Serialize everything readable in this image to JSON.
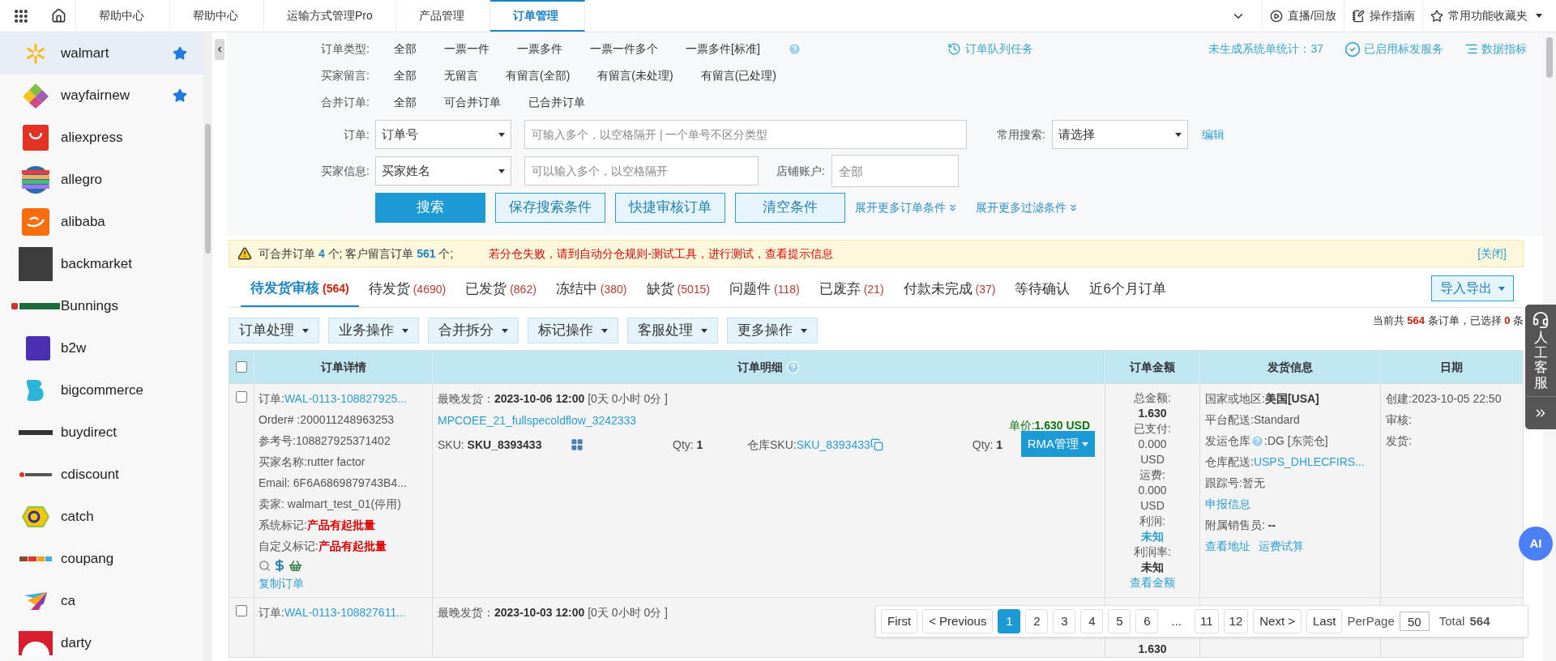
{
  "top_nav": {
    "tabs": [
      {
        "label": "帮助中心",
        "selected": false
      },
      {
        "label": "帮助中心",
        "selected": false
      },
      {
        "label": "运输方式管理Pro",
        "selected": false
      },
      {
        "label": "产品管理",
        "selected": false
      },
      {
        "label": "订单管理",
        "selected": true
      }
    ],
    "right_items": [
      {
        "label": "直播/回放",
        "kind": "play"
      },
      {
        "label": "操作指南",
        "kind": "guide"
      },
      {
        "label": "常用功能收藏夹",
        "kind": "favorites"
      }
    ]
  },
  "sidebar": {
    "items": [
      {
        "name": "walmart",
        "favorite": true,
        "selected": true
      },
      {
        "name": "wayfairnew",
        "favorite": true,
        "selected": false
      },
      {
        "name": "aliexpress",
        "favorite": false,
        "selected": false
      },
      {
        "name": "allegro",
        "favorite": false,
        "selected": false
      },
      {
        "name": "alibaba",
        "favorite": false,
        "selected": false
      },
      {
        "name": "backmarket",
        "favorite": false,
        "selected": false
      },
      {
        "name": "Bunnings",
        "favorite": false,
        "selected": false
      },
      {
        "name": "b2w",
        "favorite": false,
        "selected": false
      },
      {
        "name": "bigcommerce",
        "favorite": false,
        "selected": false
      },
      {
        "name": "buydirect",
        "favorite": false,
        "selected": false
      },
      {
        "name": "cdiscount",
        "favorite": false,
        "selected": false
      },
      {
        "name": "catch",
        "favorite": false,
        "selected": false
      },
      {
        "name": "coupang",
        "favorite": false,
        "selected": false
      },
      {
        "name": "ca",
        "favorite": false,
        "selected": false
      },
      {
        "name": "darty",
        "favorite": false,
        "selected": false
      }
    ]
  },
  "filters": {
    "option_rows": [
      {
        "label": "订单类型:",
        "options": [
          "全部",
          "一票一件",
          "一票多件",
          "一票一件多个",
          "一票多件[标准]"
        ],
        "help": true
      },
      {
        "label": "买家留言:",
        "options": [
          "全部",
          "无留言",
          "有留言(全部)",
          "有留言(未处理)",
          "有留言(已处理)"
        ],
        "help": false
      },
      {
        "label": "合并订单:",
        "options": [
          "全部",
          "可合并订单",
          "已合并订单"
        ],
        "help": false
      }
    ],
    "links": [
      {
        "label": "订单队列任务",
        "kind": "queue"
      },
      {
        "label": "未生成系统单统计：37",
        "kind": "stat"
      },
      {
        "label": "已启用标发服务",
        "kind": "service"
      },
      {
        "label": "数据指标",
        "kind": "metrics"
      }
    ],
    "order": {
      "label": "订单:",
      "select": "订单号",
      "placeholder": "可输入多个，以空格隔开 | 一个单号不区分类型"
    },
    "common_search": {
      "label": "常用搜索:",
      "select": "请选择",
      "edit": "编辑"
    },
    "buyer": {
      "label": "买家信息:",
      "select": "买家姓名",
      "placeholder": "可以输入多个，以空格隔开"
    },
    "store": {
      "label": "店铺账户:",
      "placeholder": "全部"
    },
    "buttons": [
      {
        "label": "搜索",
        "kind": "primary"
      },
      {
        "label": "保存搜索条件",
        "kind": "secondary"
      },
      {
        "label": "快捷审核订单",
        "kind": "secondary"
      },
      {
        "label": "清空条件",
        "kind": "secondary"
      }
    ],
    "expand_links": [
      "展开更多订单条件",
      "展开更多过滤条件"
    ]
  },
  "alert": {
    "summary": "可合并订单 **4** 个; 客户留言订单 **561** 个;",
    "warning": "若分仓失败，请到自动分仓规则-测试工具，进行测试，查看提示信息",
    "close": "[关闭]"
  },
  "status_tabs": [
    {
      "label": "待发货审核",
      "count": "(564)",
      "selected": true
    },
    {
      "label": "待发货",
      "count": "(4690)",
      "selected": false
    },
    {
      "label": "已发货",
      "count": "(862)",
      "selected": false
    },
    {
      "label": "冻结中",
      "count": "(380)",
      "selected": false
    },
    {
      "label": "缺货",
      "count": "(5015)",
      "selected": false
    },
    {
      "label": "问题件",
      "count": "(118)",
      "selected": false
    },
    {
      "label": "已废弃",
      "count": "(21)",
      "selected": false
    },
    {
      "label": "付款未完成",
      "count": "(37)",
      "selected": false
    },
    {
      "label": "等待确认",
      "selected": false
    },
    {
      "label": "近6个月订单",
      "selected": false
    }
  ],
  "import_export": "导入导出",
  "actions": [
    "订单处理",
    "业务操作",
    "合并拆分",
    "标记操作",
    "客服处理",
    "更多操作"
  ],
  "summary": "当前共 **564** 条订单，已选择 **0** 条",
  "table": {
    "header_checked": false,
    "columns": [
      {
        "label": "订单详情",
        "help": false
      },
      {
        "label": "订单明细",
        "help": true
      },
      {
        "label": "订单金额",
        "help": false
      },
      {
        "label": "发货信息",
        "help": false
      },
      {
        "label": "日期",
        "help": false
      }
    ],
    "rows": [
      {
        "checked": false,
        "details": [
          {
            "label": "订单:",
            "value": "WAL-0113-108827925...",
            "kind": "link"
          },
          {
            "label": "Order# :",
            "value": "200011248963253",
            "kind": "plain"
          },
          {
            "label": "参考号:",
            "value": "108827925371402",
            "kind": "plain"
          },
          {
            "label": "买家名称:",
            "value": "rutter factor",
            "kind": "plain"
          },
          {
            "label": "Email: ",
            "value": "6F6A6869879743B4...",
            "kind": "plain"
          },
          {
            "label": "卖家: ",
            "value": "walmart_test_01(停用)",
            "kind": "plain"
          },
          {
            "label": "系统标记:",
            "value": "产品有起批量",
            "kind": "flag"
          },
          {
            "label": "自定义标记:",
            "value": "产品有起批量",
            "kind": "flag"
          }
        ],
        "copy_link": "复制订单",
        "ship_by": "最晚发货：**2023-10-06 12:00** [0天 0小时 0分 ]",
        "product": "MPCOEE_21_fullspecoldflow_3242333",
        "unit_price": "单价:**1.630 USD**",
        "sku": "SKU: **SKU_8393433**",
        "qty": "Qty: **1**",
        "warehouse_sku_label": "仓库SKU:",
        "warehouse_sku": "SKU_8393433",
        "warehouse_qty": "Qty: **1**",
        "rma": "RMA管理",
        "amounts": [
          {
            "text": "总金额:",
            "kind": "label"
          },
          {
            "text": "1.630",
            "kind": "strong"
          },
          {
            "text": "已支付:",
            "kind": "label"
          },
          {
            "text": "0.000",
            "kind": "label"
          },
          {
            "text": "USD",
            "kind": "label"
          },
          {
            "text": "运费:",
            "kind": "label"
          },
          {
            "text": "0.000",
            "kind": "label"
          },
          {
            "text": "USD",
            "kind": "label"
          },
          {
            "text": "利润:",
            "kind": "label"
          },
          {
            "text": "未知",
            "kind": "accent"
          },
          {
            "text": "利润率:",
            "kind": "label"
          },
          {
            "text": "未知",
            "kind": "strong"
          },
          {
            "text": "查看金额",
            "kind": "link"
          }
        ],
        "shipping": [
          {
            "kind": "strong_field",
            "label": "国家或地区:",
            "value": "美国[USA]"
          },
          {
            "kind": "field",
            "label": "平台配送:",
            "value": "Standard"
          },
          {
            "kind": "help_field",
            "label": "发运仓库",
            "value": ":DG [东莞仓]"
          },
          {
            "kind": "link_field",
            "label": "仓库配送:",
            "value": "USPS_DHLECFIRS..."
          },
          {
            "kind": "field",
            "label": "跟踪号:",
            "value": "暂无"
          },
          {
            "kind": "links",
            "links": [
              "申报信息"
            ]
          },
          {
            "kind": "strong_field",
            "label": "附属销售员: ",
            "value": "--"
          },
          {
            "kind": "links",
            "links": [
              "查看地址",
              "运费试算"
            ]
          }
        ],
        "dates": [
          {
            "label": "创建:",
            "value": "2023-10-05 22:50"
          },
          {
            "label": "审核:"
          },
          {
            "label": "发货:"
          }
        ]
      },
      {
        "checked": false,
        "details": [
          {
            "label": "订单:",
            "value": "WAL-0113-108827611...",
            "kind": "link"
          }
        ],
        "ship_by": "最晚发货：**2023-10-03 12:00** [0天 0小时 0分 ]",
        "amounts": [
          {
            "text": "1.630",
            "kind": "strong"
          }
        ]
      }
    ]
  },
  "pagination": {
    "first": "First",
    "previous": "< Previous",
    "pages": [
      {
        "label": "1",
        "selected": true
      },
      {
        "label": "2",
        "selected": false
      },
      {
        "label": "3",
        "selected": false
      },
      {
        "label": "4",
        "selected": false
      },
      {
        "label": "5",
        "selected": false
      },
      {
        "label": "6",
        "selected": false
      },
      {
        "label": "...",
        "kind": "gap"
      },
      {
        "label": "11",
        "selected": false
      },
      {
        "label": "12",
        "selected": false
      }
    ],
    "next": "Next >",
    "last": "Last",
    "per_page_label": "PerPage",
    "per_page": "50",
    "total_label": "Total",
    "total": "564"
  },
  "support": {
    "label": "人工客服",
    "ai": "AI"
  }
}
